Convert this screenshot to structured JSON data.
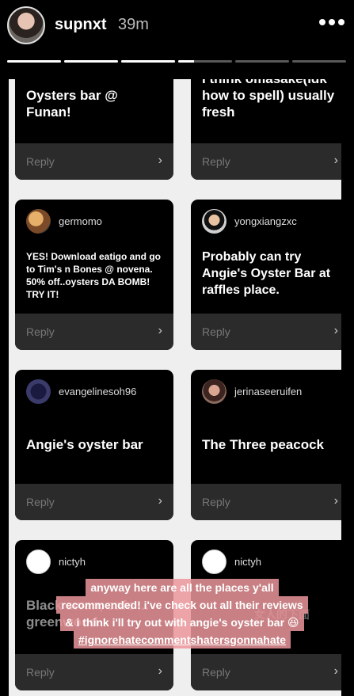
{
  "story": {
    "username": "supnxt",
    "time": "39m",
    "more_icon": "more-horizontal-icon",
    "progress": [
      1,
      1,
      1,
      0.3,
      0,
      0
    ]
  },
  "cards": [
    {
      "id": "c1",
      "handle": "",
      "body": "Oysters bar @ Funan!",
      "reply": "Reply"
    },
    {
      "id": "c2",
      "handle": "",
      "body": "I think omasake(idk how to spell) usually fresh",
      "reply": "Reply"
    },
    {
      "id": "c3",
      "handle": "germomo",
      "body": "YES! Download eatigo and go to Tim's n Bones @ novena. 50% off..oysters DA BOMB! TRY IT!",
      "reply": "Reply"
    },
    {
      "id": "c4",
      "handle": "yongxiangzxc",
      "body": "Probably can try Angie's Oyster Bar at raffles place.",
      "reply": "Reply"
    },
    {
      "id": "c5",
      "handle": "evangelinesoh96",
      "body": "Angie's oyster bar",
      "reply": "Reply"
    },
    {
      "id": "c6",
      "handle": "jerinaseeruifen",
      "body": "The Three peacock",
      "reply": "Reply"
    },
    {
      "id": "c7",
      "handle": "nictyh",
      "body": "Black swan, cafe ... greenwood",
      "reply": "Reply"
    },
    {
      "id": "c8",
      "handle": "nictyh",
      "body": "女人的下面",
      "reply": "Reply"
    }
  ],
  "caption": {
    "line1": "anyway here are all the places y'all",
    "line2": "recommended! i've check out all their reviews",
    "line3": "& i think i'll try out with angie's oyster bar 😆",
    "line4": "#ignorehatecommentshatersgonnahate"
  }
}
